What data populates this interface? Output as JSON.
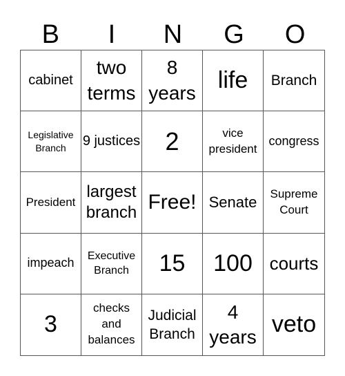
{
  "header": [
    "B",
    "I",
    "N",
    "G",
    "O"
  ],
  "cells": [
    "cabinet",
    "two terms",
    "8 years",
    "life",
    "Branch",
    "Legislative Branch",
    "9 justices",
    "2",
    "vice president",
    "congress",
    "President",
    "largest branch",
    "Free!",
    "Senate",
    "Supreme Court",
    "impeach",
    "Executive Branch",
    "15",
    "100",
    "courts",
    "3",
    "checks and balances",
    "Judicial Branch",
    "4 years",
    "veto"
  ]
}
